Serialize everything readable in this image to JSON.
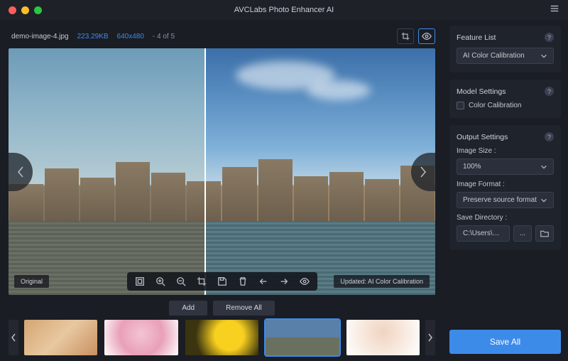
{
  "app": {
    "title": "AVCLabs Photo Enhancer AI"
  },
  "file": {
    "name": "demo-image-4.jpg",
    "size": "223.29KB",
    "dimensions": "640x480",
    "index_label": "- 4 of 5"
  },
  "preview": {
    "original_label": "Original",
    "updated_label": "Updated: AI Color Calibration"
  },
  "thumb_actions": {
    "add": "Add",
    "remove_all": "Remove All"
  },
  "panels": {
    "feature_list": {
      "title": "Feature List",
      "selected": "AI Color Calibration"
    },
    "model_settings": {
      "title": "Model Settings",
      "checkbox_label": "Color Calibration"
    },
    "output_settings": {
      "title": "Output Settings",
      "image_size_label": "Image Size :",
      "image_size_value": "100%",
      "image_format_label": "Image Format :",
      "image_format_value": "Preserve source format",
      "save_dir_label": "Save Directory :",
      "save_dir_value": "C:\\Users\\Nova",
      "browse_dots": "..."
    }
  },
  "save_button": "Save All"
}
